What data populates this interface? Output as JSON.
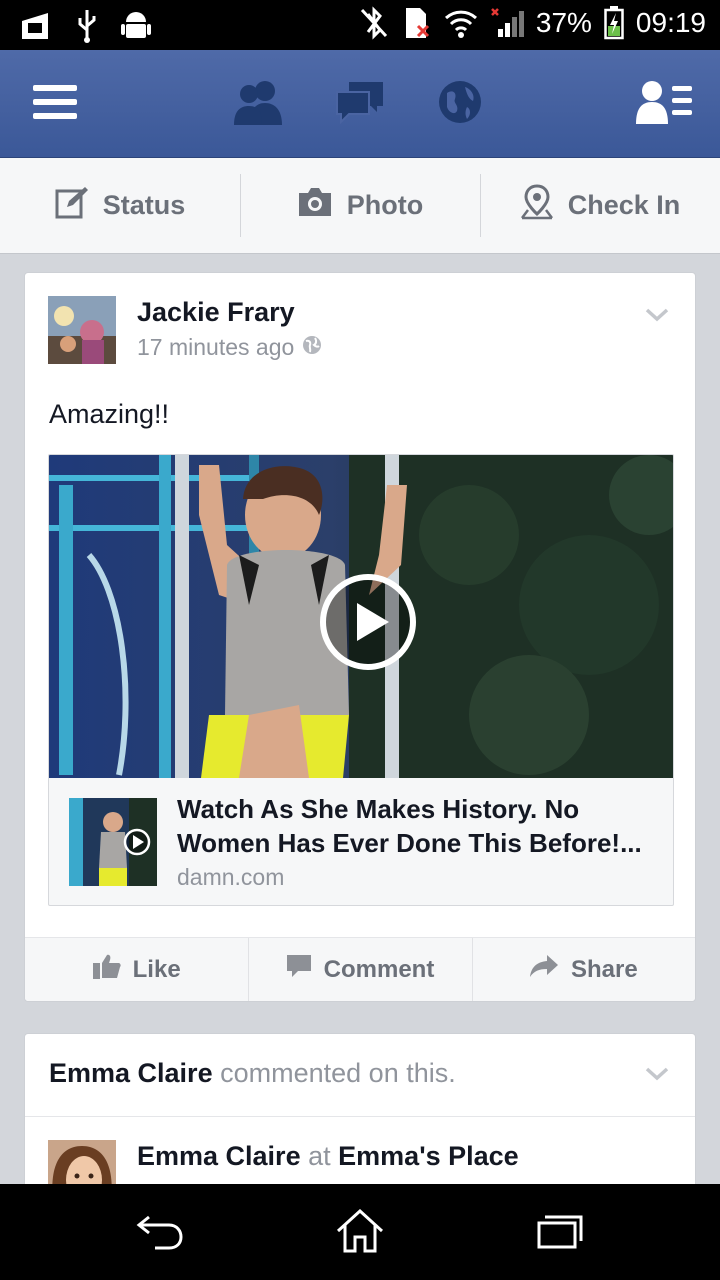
{
  "status_bar": {
    "battery_percent": "37%",
    "time": "09:19"
  },
  "top_nav": {
    "icons": [
      "menu-icon",
      "friends-icon",
      "messages-icon",
      "notifications-globe-icon",
      "chat-contacts-icon"
    ]
  },
  "composer": {
    "status_label": "Status",
    "photo_label": "Photo",
    "checkin_label": "Check In"
  },
  "post": {
    "author": "Jackie Frary",
    "time": "17 minutes ago",
    "text": "Amazing!!",
    "link": {
      "title": "Watch As She Makes History. No Women Has Ever Done This Before!...",
      "domain": "damn.com"
    },
    "actions": {
      "like": "Like",
      "comment": "Comment",
      "share": "Share"
    }
  },
  "story2": {
    "actor": "Emma Claire",
    "activity": "commented on this.",
    "post_author": "Emma Claire",
    "at_word": "at",
    "place": "Emma's Place"
  },
  "colors": {
    "nav_blue": "#3b5898",
    "text_dark": "#141823",
    "text_light": "#90949c"
  }
}
